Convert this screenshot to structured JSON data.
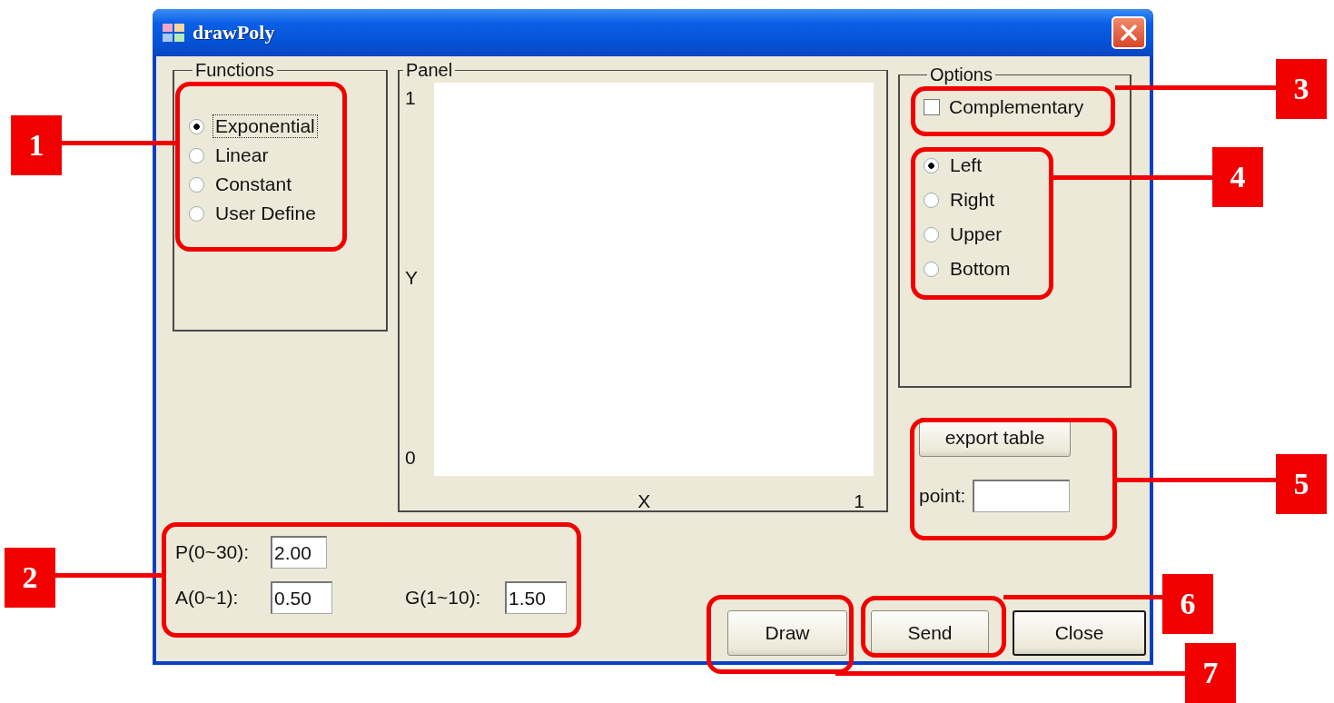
{
  "window": {
    "title": "drawPoly"
  },
  "functions": {
    "title": "Functions",
    "options": [
      {
        "label": "Exponential",
        "selected": true,
        "focused": true
      },
      {
        "label": "Linear",
        "selected": false,
        "focused": false
      },
      {
        "label": "Constant",
        "selected": false,
        "focused": false
      },
      {
        "label": "User Define",
        "selected": false,
        "focused": false
      }
    ]
  },
  "panel": {
    "title": "Panel",
    "y_max": "1",
    "y_label": "Y",
    "y_min": "0",
    "x_label": "X",
    "x_max": "1"
  },
  "options": {
    "title": "Options",
    "complementary": {
      "label": "Complementary",
      "checked": false
    },
    "sides": [
      {
        "label": "Left",
        "selected": true
      },
      {
        "label": "Right",
        "selected": false
      },
      {
        "label": "Upper",
        "selected": false
      },
      {
        "label": "Bottom",
        "selected": false
      }
    ]
  },
  "export_button": "export table",
  "point": {
    "label": "point:"
  },
  "params": [
    {
      "label": "P(0~30):",
      "value": "2.00"
    },
    {
      "label": "A(0~1):",
      "value": "0.50"
    },
    {
      "label": "G(1~10):",
      "value": "1.50"
    }
  ],
  "buttons": [
    {
      "label": "Draw",
      "default": false
    },
    {
      "label": "Send",
      "default": false
    },
    {
      "label": "Close",
      "default": true
    }
  ],
  "callouts": [
    {
      "label": "1"
    },
    {
      "label": "2"
    },
    {
      "label": "3"
    },
    {
      "label": "4"
    },
    {
      "label": "5"
    },
    {
      "label": "6"
    },
    {
      "label": "7"
    }
  ]
}
